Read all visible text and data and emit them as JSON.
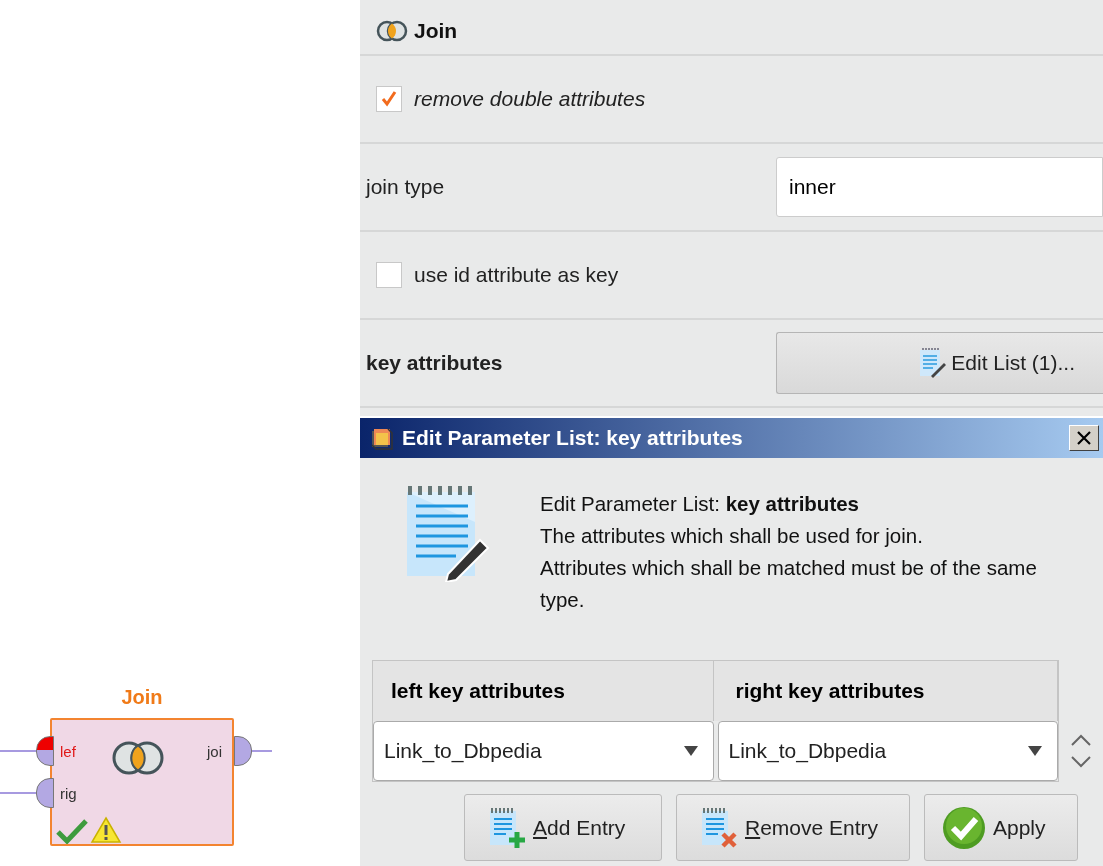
{
  "canvas": {
    "operator": {
      "title": "Join",
      "ports_in": [
        {
          "label": "lef",
          "error": true
        },
        {
          "label": "rig",
          "error": false
        }
      ],
      "ports_out": [
        {
          "label": "joi"
        }
      ],
      "status_ok": true,
      "warning": true
    }
  },
  "panel": {
    "title": "Join",
    "parameters": [
      {
        "kind": "checkbox",
        "label": "remove double attributes",
        "checked": true
      },
      {
        "kind": "select",
        "label": "join type",
        "value": "inner"
      },
      {
        "kind": "checkbox",
        "label": "use id attribute as key",
        "checked": false
      },
      {
        "kind": "list",
        "label": "key attributes",
        "button": "Edit List (1)..."
      }
    ]
  },
  "dialog": {
    "title": "Edit Parameter List: key attributes",
    "heading": "Edit Parameter List: **key attributes**",
    "description": [
      "The attributes which shall be used for join.",
      "Attributes which shall be matched must be of the same type."
    ],
    "columns": [
      "left key attributes",
      "right key attributes"
    ],
    "rows": [
      [
        "Link_to_Dbpedia",
        "Link_to_Dbpedia"
      ]
    ],
    "buttons": [
      {
        "kind": "add",
        "mnemonic": "A",
        "label": "dd Entry"
      },
      {
        "kind": "remove",
        "mnemonic": "R",
        "label": "emove Entry"
      },
      {
        "kind": "apply",
        "label": "Apply"
      }
    ]
  }
}
